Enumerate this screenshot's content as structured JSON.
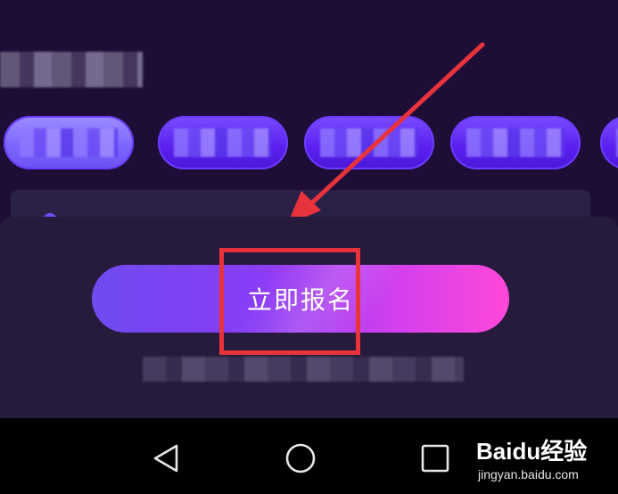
{
  "main": {
    "signup_button_label": "立即报名"
  },
  "category_pills": [
    {
      "state": "active"
    },
    {
      "state": "normal"
    },
    {
      "state": "normal"
    },
    {
      "state": "normal"
    },
    {
      "state": "partial"
    }
  ],
  "nav": {
    "back_icon": "triangle-back-icon",
    "home_icon": "circle-home-icon",
    "recents_icon": "square-recents-icon"
  },
  "watermark": {
    "logo": "Baidu经验",
    "url": "jingyan.baidu.com"
  },
  "colors": {
    "background": "#1e0e37",
    "sheet": "#261b3c",
    "button_start": "#6f4bf0",
    "button_end": "#ff48d9",
    "annotation": "#e8333c"
  }
}
